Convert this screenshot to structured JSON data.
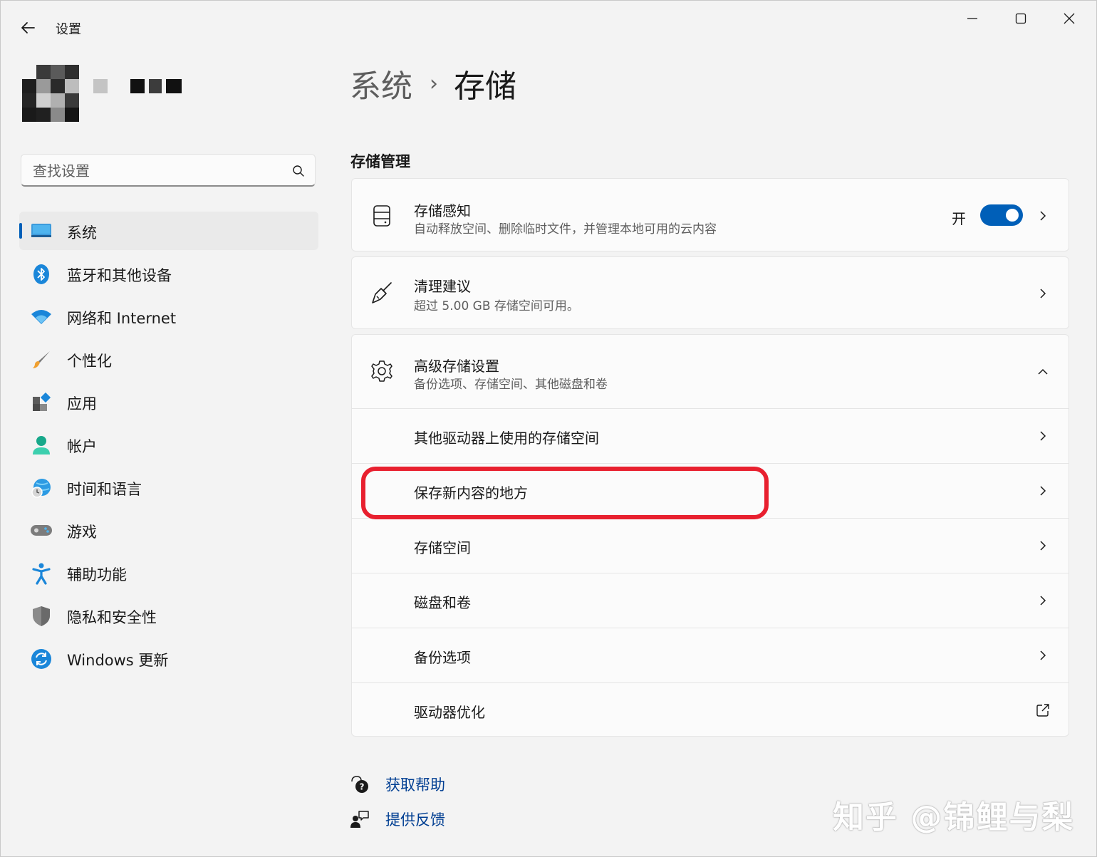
{
  "window": {
    "title": "设置",
    "controls": [
      "minimize-icon",
      "maximize-icon",
      "close-icon"
    ]
  },
  "profile": {
    "name_redacted": true
  },
  "search": {
    "placeholder": "查找设置",
    "value": ""
  },
  "sidebar": {
    "items": [
      {
        "label": "系统",
        "icon": "system-monitor-icon",
        "active": true
      },
      {
        "label": "蓝牙和其他设备",
        "icon": "bluetooth-icon",
        "active": false
      },
      {
        "label": "网络和 Internet",
        "icon": "wifi-icon",
        "active": false
      },
      {
        "label": "个性化",
        "icon": "brush-icon",
        "active": false
      },
      {
        "label": "应用",
        "icon": "apps-icon",
        "active": false
      },
      {
        "label": "帐户",
        "icon": "account-icon",
        "active": false
      },
      {
        "label": "时间和语言",
        "icon": "time-language-icon",
        "active": false
      },
      {
        "label": "游戏",
        "icon": "gamepad-icon",
        "active": false
      },
      {
        "label": "辅助功能",
        "icon": "accessibility-icon",
        "active": false
      },
      {
        "label": "隐私和安全性",
        "icon": "shield-icon",
        "active": false
      },
      {
        "label": "Windows 更新",
        "icon": "windows-update-icon",
        "active": false
      }
    ]
  },
  "breadcrumb": {
    "parent": "系统",
    "separator": "›",
    "current": "存储"
  },
  "main": {
    "section_title": "存储管理",
    "storage_sense": {
      "title": "存储感知",
      "subtitle": "自动释放空间、删除临时文件，并管理本地可用的云内容",
      "toggle_label": "开",
      "toggle_on": true
    },
    "cleanup": {
      "title": "清理建议",
      "subtitle": "超过 5.00 GB 存储空间可用。"
    },
    "advanced": {
      "title": "高级存储设置",
      "subtitle": "备份选项、存储空间、其他磁盘和卷",
      "expanded": true,
      "items": [
        {
          "label": "其他驱动器上使用的存储空间",
          "action": "chevron-right-icon"
        },
        {
          "label": "保存新内容的地方",
          "action": "chevron-right-icon"
        },
        {
          "label": "存储空间",
          "action": "chevron-right-icon"
        },
        {
          "label": "磁盘和卷",
          "action": "chevron-right-icon"
        },
        {
          "label": "备份选项",
          "action": "chevron-right-icon"
        },
        {
          "label": "驱动器优化",
          "action": "external-link-icon"
        }
      ]
    }
  },
  "footer": {
    "help": "获取帮助",
    "feedback": "提供反馈"
  },
  "watermark": "知乎 @锦鲤与梨",
  "colors": {
    "accent": "#005fb8",
    "highlight": "#e8202f",
    "link": "#003e92",
    "background": "#f3f3f3",
    "card": "#fbfbfb"
  }
}
